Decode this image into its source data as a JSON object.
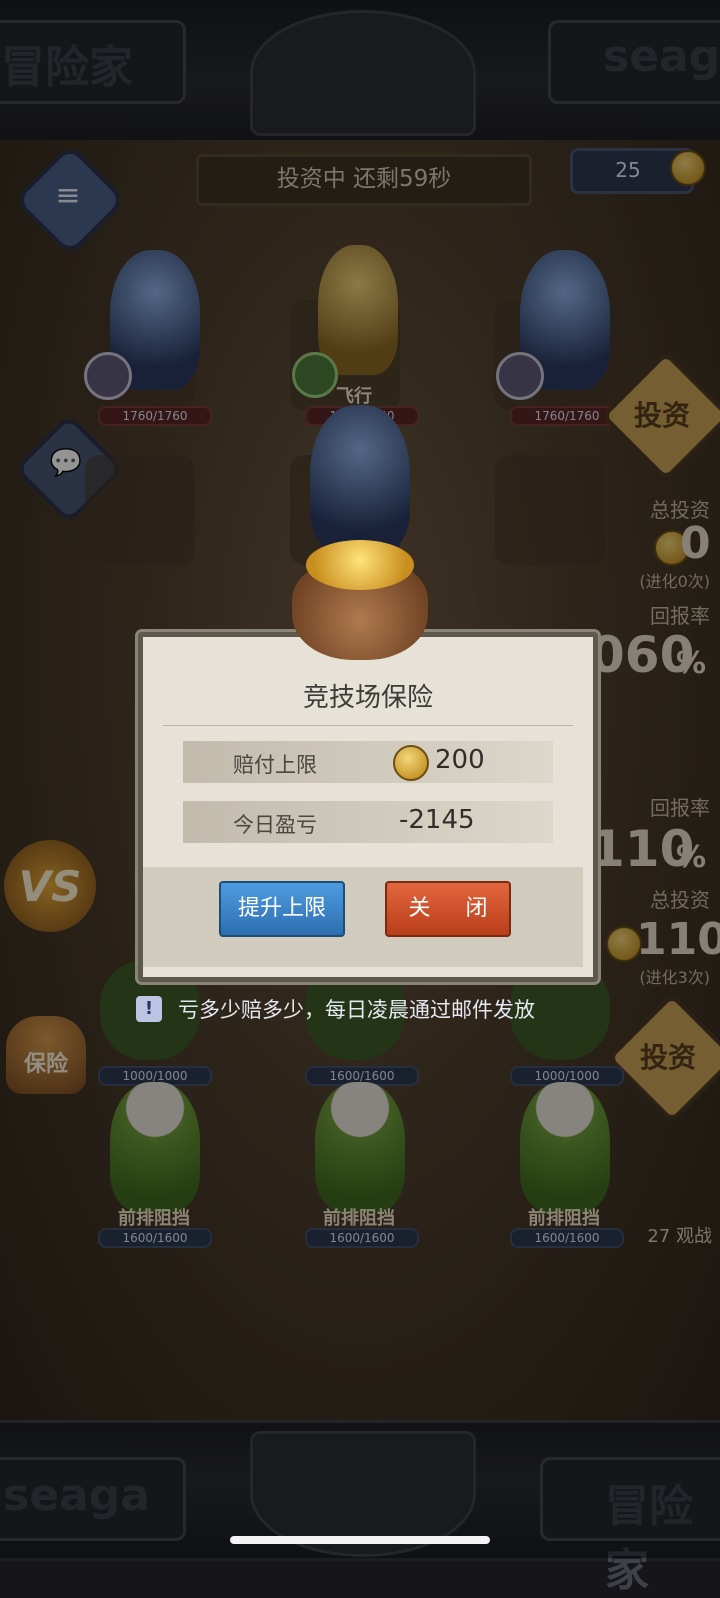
{
  "header": {
    "left_logo": "冒险家",
    "right_logo": "seaga"
  },
  "top": {
    "timer_text": "投资中 还剩59秒",
    "coin_count": "25"
  },
  "units": {
    "top_left_hp": "1760/1760",
    "top_mid_hp": "1340/1340",
    "top_mid_label": "飞行",
    "top_right_hp": "1760/1760",
    "bot_row1_left_hp": "1000/1000",
    "bot_row1_mid_hp": "1600/1600",
    "bot_row1_right_hp": "1000/1000",
    "bot_row2_left_hp": "1600/1600",
    "bot_row2_mid_hp": "1600/1600",
    "bot_row2_right_hp": "1600/1600",
    "bot_row2_label": "前排阻挡"
  },
  "right_panel": {
    "invest_button": "投资",
    "top_total_label": "总投资",
    "top_total_value": "0",
    "top_evolve": "(进化0次)",
    "top_return_label": "回报率",
    "top_return_value": "060",
    "top_return_unit": "%",
    "bot_return_label": "回报率",
    "bot_return_value": "110",
    "bot_return_unit": "%",
    "bot_total_label": "总投资",
    "bot_total_value": "110",
    "bot_evolve": "(进化3次)",
    "bot_invest_button": "投资",
    "spectators": "27 观战"
  },
  "left_panel": {
    "vs_label": "VS",
    "insurance_label": "保险"
  },
  "dialog": {
    "title": "竞技场保险",
    "payout_limit_label": "赔付上限",
    "payout_limit_value": "200",
    "today_pl_label": "今日盈亏",
    "today_pl_value": "-2145",
    "raise_button": "提升上限",
    "close_button": "关 闭"
  },
  "notice": {
    "icon": "!",
    "text": "亏多少赔多少，每日凌晨通过邮件发放"
  },
  "footer": {
    "left_logo": "seaga",
    "right_logo": "冒险家"
  }
}
